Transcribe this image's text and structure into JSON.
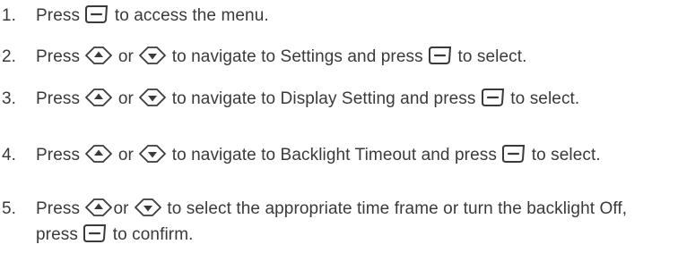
{
  "steps": [
    {
      "number": "1.",
      "parts": [
        "Press ",
        "menu-key-icon",
        " to access the menu."
      ]
    },
    {
      "number": "2.",
      "parts": [
        "Press ",
        "nav-up-key-icon",
        " or ",
        "nav-down-key-icon",
        " to navigate to Settings and press ",
        "menu-key-icon",
        " to select."
      ]
    },
    {
      "number": "3.",
      "parts": [
        "Press ",
        "nav-up-key-icon",
        " or ",
        "nav-down-key-icon",
        " to navigate to Display Setting and press ",
        "menu-key-icon",
        " to select."
      ]
    },
    {
      "number": "4.",
      "parts": [
        "Press ",
        "nav-up-key-icon",
        " or ",
        "nav-down-key-icon",
        " to navigate to Backlight Timeout and press ",
        "menu-key-icon",
        " to select."
      ]
    },
    {
      "number": "5.",
      "parts": [
        "Press ",
        "nav-up-key-icon",
        "or ",
        "nav-down-key-icon",
        " to select the appropriate time frame or turn the backlight Off, press ",
        "menu-key-icon",
        " to confirm."
      ]
    }
  ],
  "colors": {
    "text": "#3a3a3a",
    "icon": "#3a3a3a"
  }
}
